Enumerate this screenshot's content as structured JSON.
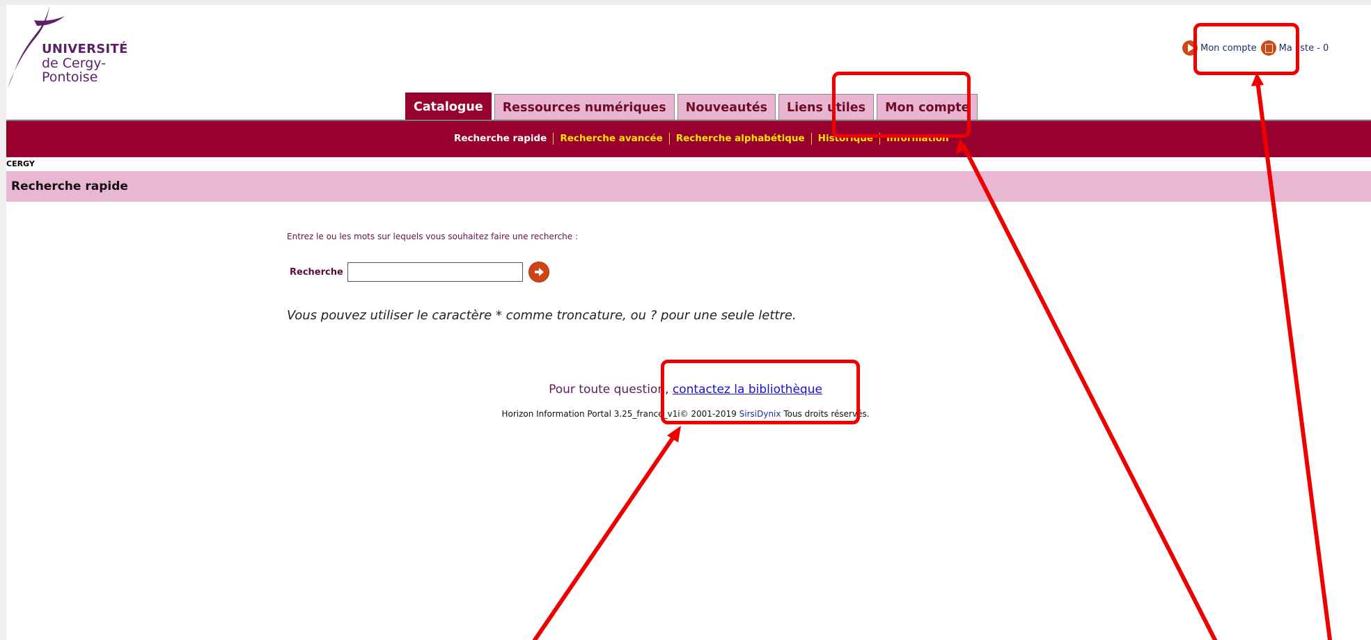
{
  "logo": {
    "line1": "UNIVERSITÉ",
    "line2": "de Cergy-Pontoise"
  },
  "toplinks": {
    "account": "Mon compte",
    "list": "Ma liste - 0"
  },
  "tabs": [
    {
      "label": "Catalogue",
      "active": true
    },
    {
      "label": "Ressources numériques",
      "active": false
    },
    {
      "label": "Nouveautés",
      "active": false
    },
    {
      "label": "Liens utiles",
      "active": false
    },
    {
      "label": "Mon compte",
      "active": false
    }
  ],
  "subnav": [
    "Recherche rapide",
    "Recherche avancée",
    "Recherche alphabétique",
    "Historique",
    "Information"
  ],
  "location": "CERGY",
  "page_title": "Recherche rapide",
  "intro": "Entrez le ou les mots sur lequels vous souhaitez faire une recherche :",
  "search": {
    "label": "Recherche",
    "value": ""
  },
  "hint": "Vous pouvez utiliser le caractère * comme troncature, ou ? pour une seule lettre.",
  "footer": {
    "question": "Pour toute question, ",
    "contact_link": "contactez la bibliothèque",
    "copyright_pre": "Horizon Information Portal 3.25_france_v1i© 2001-2019 ",
    "copyright_link": "SirsiDynix",
    "copyright_post": " Tous droits réservés."
  },
  "colors": {
    "brand": "#98002e",
    "tab_inactive": "#eab5d1",
    "subnav_link": "#ffe400",
    "annotation": "#ee0000"
  },
  "icons": [
    "university-logo-icon",
    "play-circle-icon",
    "list-icon",
    "arrow-right-circle-icon"
  ]
}
